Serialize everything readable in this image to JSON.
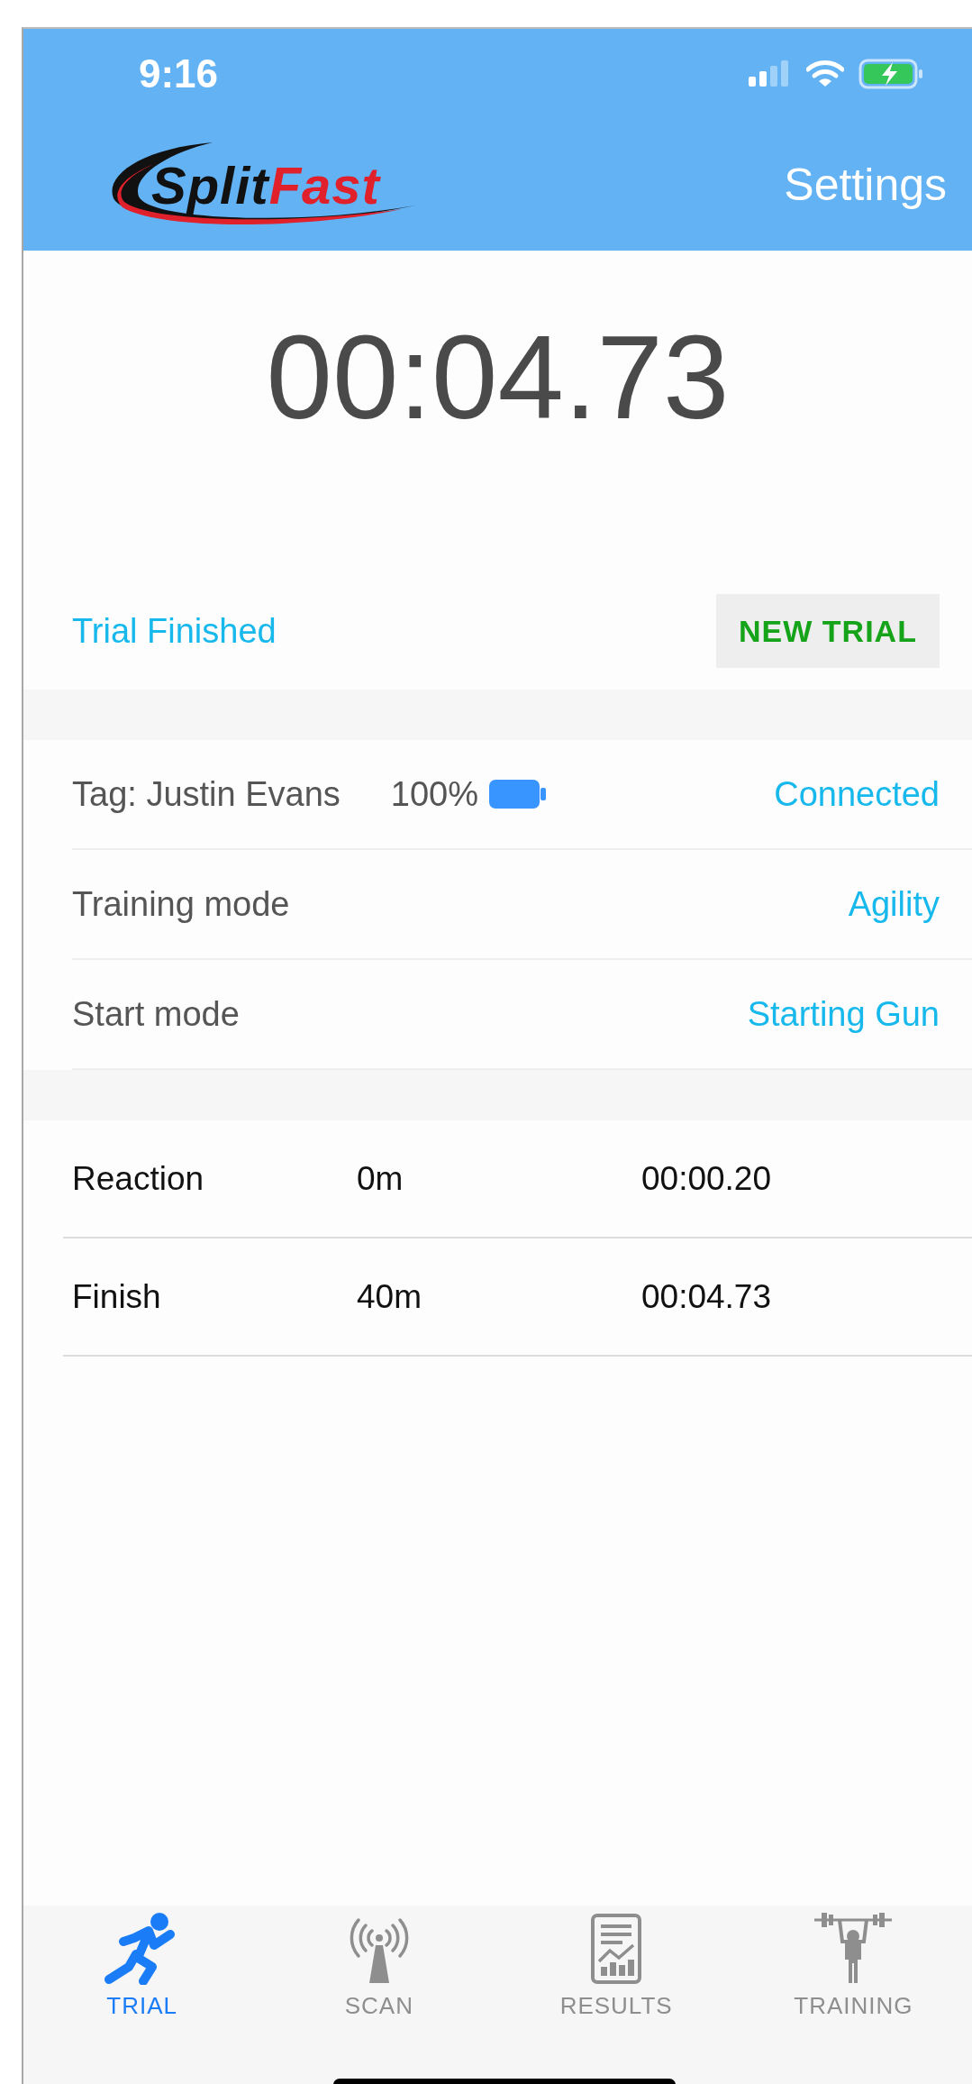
{
  "status_bar": {
    "time": "9:16"
  },
  "header": {
    "logo": {
      "part_1": "Split",
      "part_2": "Fast"
    },
    "settings": "Settings"
  },
  "timer": "00:04.73",
  "trial_status": "Trial Finished",
  "new_trial_button": "NEW TRIAL",
  "info_rows": [
    {
      "kind": "tag",
      "label": "Tag: Justin Evans",
      "battery": "100%",
      "value": "Connected"
    },
    {
      "kind": "plain",
      "label": "Training mode",
      "value": "Agility"
    },
    {
      "kind": "plain",
      "label": "Start mode",
      "value": "Starting Gun"
    }
  ],
  "splits": [
    {
      "name": "Reaction",
      "distance": "0m",
      "time": "00:00.20"
    },
    {
      "name": "Finish",
      "distance": "40m",
      "time": "00:04.73"
    }
  ],
  "tabs": [
    {
      "label": "TRIAL",
      "kind": "runner",
      "selected": true
    },
    {
      "label": "SCAN",
      "kind": "antenna",
      "selected": false
    },
    {
      "label": "RESULTS",
      "kind": "report",
      "selected": false
    },
    {
      "label": "TRAINING",
      "kind": "lifter",
      "selected": false
    }
  ]
}
